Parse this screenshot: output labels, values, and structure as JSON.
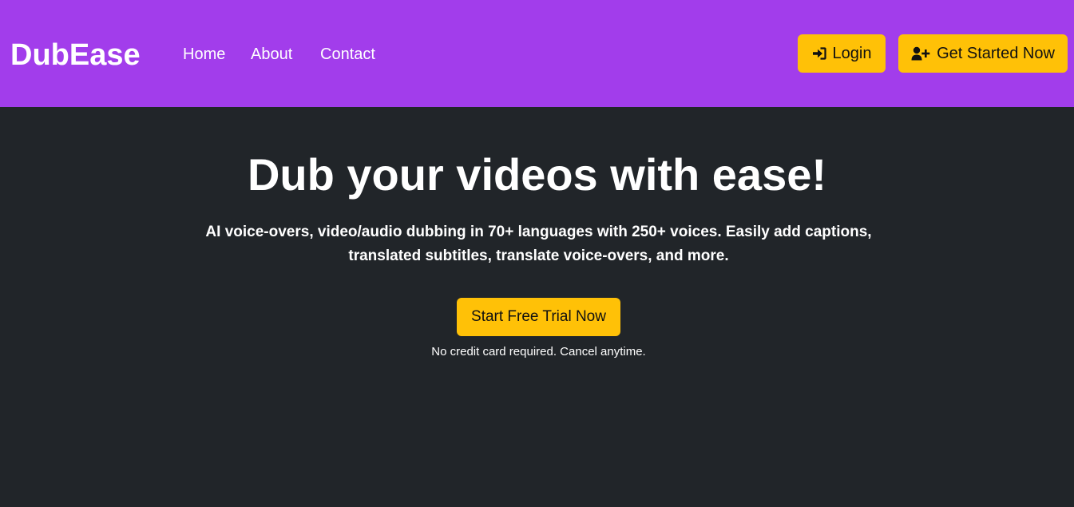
{
  "navbar": {
    "brand": "DubEase",
    "links": [
      {
        "label": "Home"
      },
      {
        "label": "About"
      },
      {
        "label": "Contact"
      }
    ],
    "login_label": "Login",
    "get_started_label": "Get Started Now",
    "icons": {
      "login": "sign-in-icon",
      "get_started": "user-plus-icon"
    }
  },
  "hero": {
    "title": "Dub your videos with ease!",
    "subtitle_line1": "AI voice-overs, video/audio dubbing in 70+ languages with 250+ voices. Easily add captions,",
    "subtitle_line2": "translated subtitles, translate voice-overs, and more.",
    "cta_label": "Start Free Trial Now",
    "note": "No credit card required. Cancel anytime."
  },
  "colors": {
    "navbar_bg": "#a23deb",
    "page_bg": "#212529",
    "accent": "#ffc107",
    "text": "#ffffff"
  }
}
